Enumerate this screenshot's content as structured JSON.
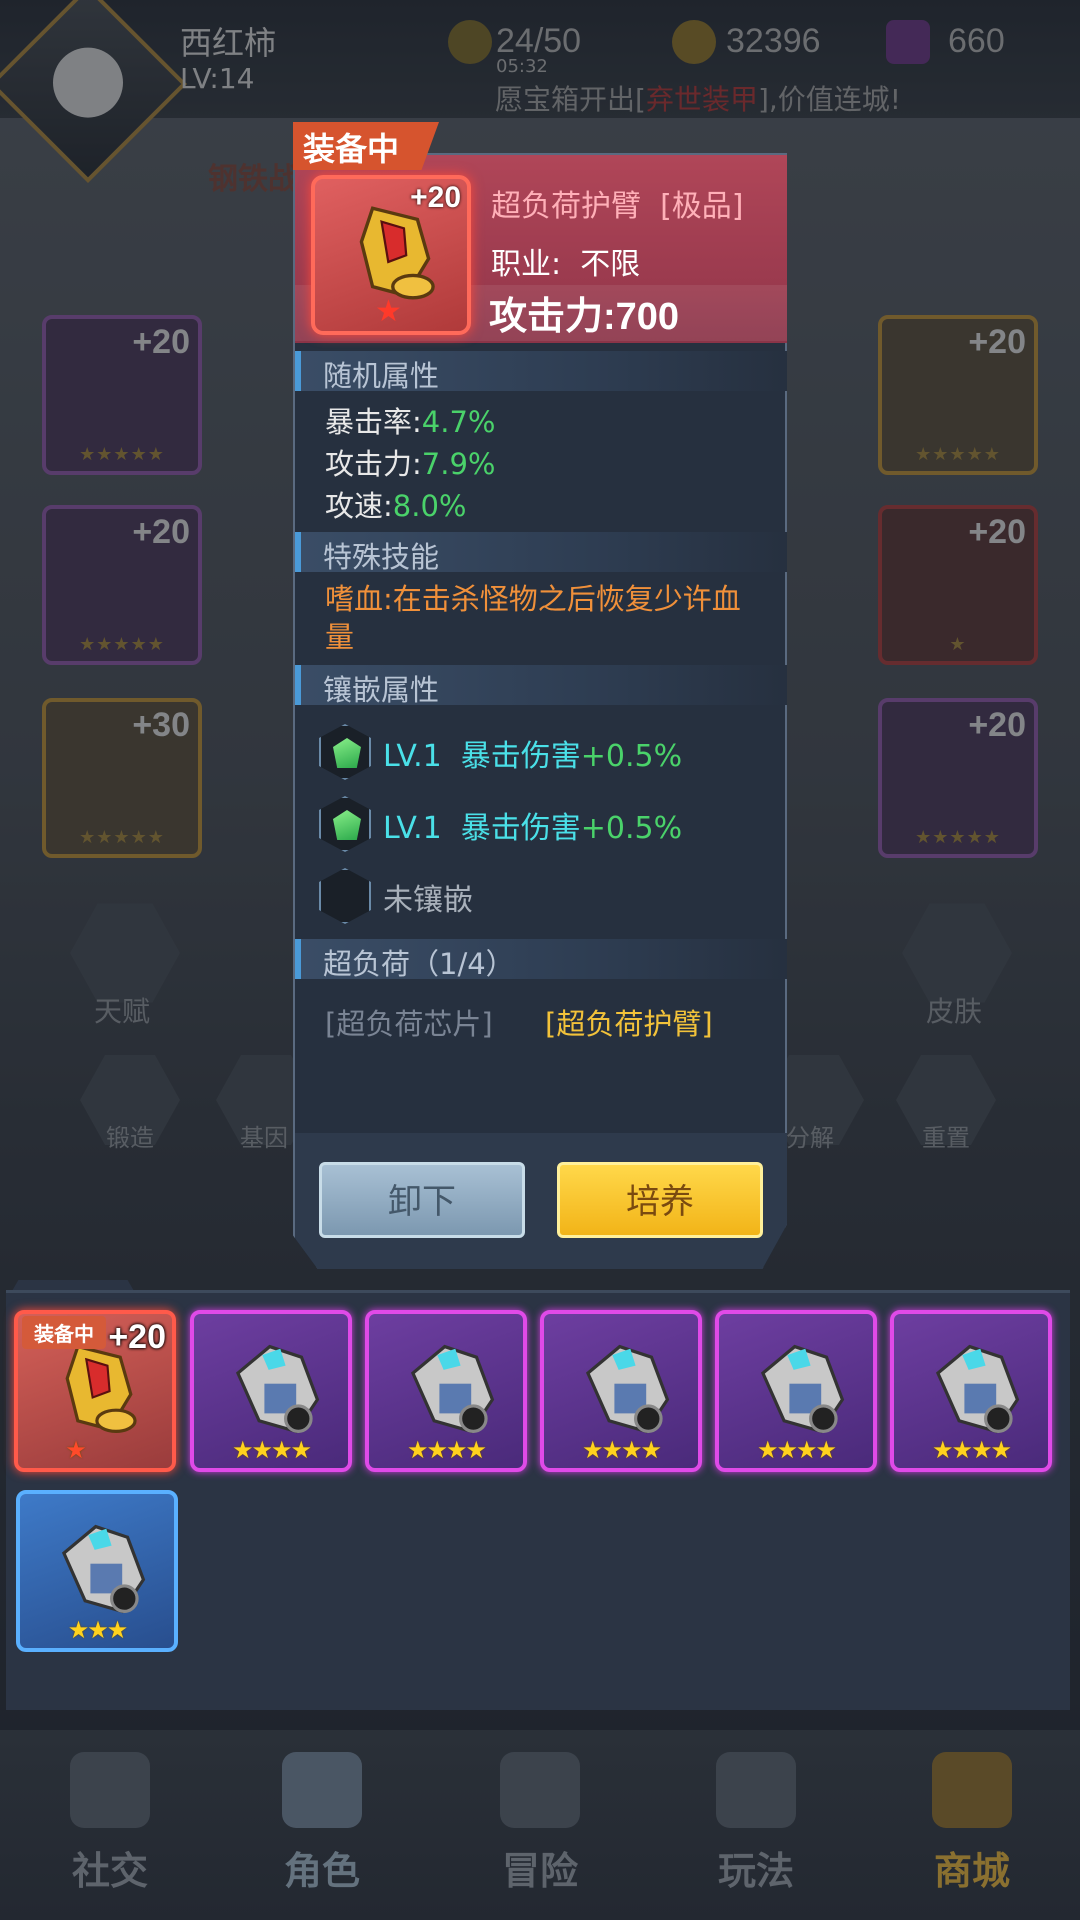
{
  "player": {
    "name": "西红柿",
    "level": "LV:14"
  },
  "resources": {
    "energy": "24/50",
    "energy_timer": "05:32",
    "gold": "32396",
    "gems": "660"
  },
  "news": {
    "prefix": "愿宝箱开出[",
    "highlight": "弃世装甲",
    "suffix": "],价值连城!"
  },
  "background": {
    "event_banner": "钢铁战",
    "side_slots": [
      {
        "plus": "+20",
        "stars": "★★★★★"
      },
      {
        "plus": "+20",
        "stars": "★★★★★"
      },
      {
        "plus": "+30",
        "stars": "★★★★★"
      },
      {
        "plus": "+20",
        "stars": "★★★★★"
      },
      {
        "plus": "+20",
        "stars": "★"
      },
      {
        "plus": "+20",
        "stars": "★★★★★"
      }
    ],
    "talent_label": "天赋",
    "skin_label": "皮肤",
    "forge_label": "锻造",
    "gene_label": "基因",
    "decompose_label": "分解",
    "reset_label": "重置"
  },
  "detail": {
    "equipped_badge": "装备中",
    "item_plus": "+20",
    "item_name": "超负荷护臂",
    "item_grade": "[极品]",
    "class_label": "职业:",
    "class_value": "不限",
    "attack": "攻击力:700",
    "random_section": "随机属性",
    "random_attrs": [
      {
        "name": "暴击率:",
        "value": "4.7%"
      },
      {
        "name": "攻击力:",
        "value": "7.9%"
      },
      {
        "name": "攻速:",
        "value": "8.0%"
      }
    ],
    "skill_section": "特殊技能",
    "skill_text": "嗜血:在击杀怪物之后恢复少许血量",
    "socket_section": "镶嵌属性",
    "sockets": [
      {
        "level": "LV.1",
        "attr": "暴击伤害",
        "value": "+0.5%"
      },
      {
        "level": "LV.1",
        "attr": "暴击伤害",
        "value": "+0.5%"
      }
    ],
    "empty_socket": "未镶嵌",
    "set_section": "超负荷（1/4）",
    "set_pieces": [
      {
        "name": "[超负荷芯片]",
        "owned": false
      },
      {
        "name": "[超负荷护臂]",
        "owned": true
      }
    ],
    "unequip_button": "卸下",
    "train_button": "培养"
  },
  "inventory": {
    "items": [
      {
        "rarity": "red",
        "plus": "+20",
        "tag": "装备中",
        "stars": "★"
      },
      {
        "rarity": "purple",
        "stars": "★★★★"
      },
      {
        "rarity": "purple",
        "stars": "★★★★"
      },
      {
        "rarity": "purple",
        "stars": "★★★★"
      },
      {
        "rarity": "purple",
        "stars": "★★★★"
      },
      {
        "rarity": "purple",
        "stars": "★★★★"
      },
      {
        "rarity": "blue",
        "stars": "★★★"
      }
    ]
  },
  "nav": {
    "items": [
      {
        "label": "社交"
      },
      {
        "label": "角色"
      },
      {
        "label": "冒险"
      },
      {
        "label": "玩法"
      },
      {
        "label": "商城"
      }
    ]
  },
  "colors": {
    "accent_gold": "#f2b418",
    "rarity_red": "#ff5a4a",
    "rarity_purple": "#e04ae8",
    "rarity_blue": "#5ab0ff",
    "stat_green": "#4ad26a"
  }
}
